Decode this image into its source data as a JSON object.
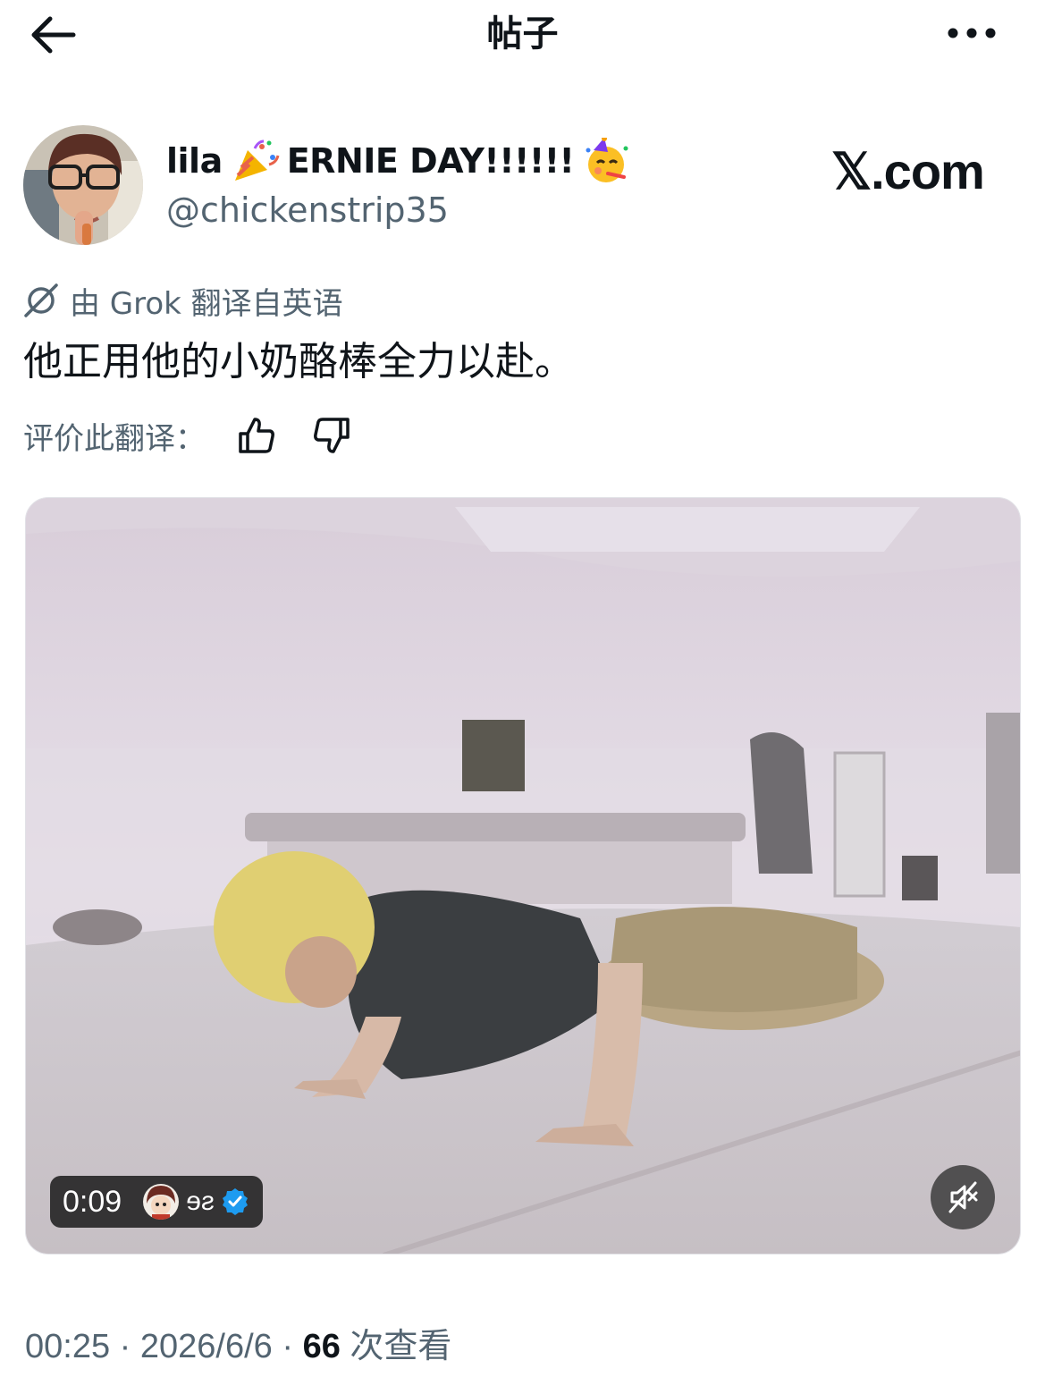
{
  "header": {
    "title": "帖子"
  },
  "author": {
    "name_part1": "lila",
    "name_part2": "ERNIE DAY!!!!!!",
    "handle": "@chickenstrip35",
    "emoji1": "party-popper-icon",
    "emoji2": "partying-face-icon"
  },
  "watermark": "𝕏.com",
  "translation": {
    "label": "由 Grok 翻译自英语",
    "text": "他正用他的小奶酪棒全力以赴。",
    "rate_label": "评价此翻译："
  },
  "media": {
    "duration": "0:09",
    "source_name": "ɘƨ",
    "verified": true
  },
  "meta": {
    "time": "00:25",
    "sep1": " · ",
    "date": "2026/6/6",
    "sep2": " · ",
    "views": "66",
    "views_label": " 次查看"
  },
  "colors": {
    "text_primary": "#0f1419",
    "text_secondary": "#536471",
    "verified_blue": "#1d9bf0"
  }
}
